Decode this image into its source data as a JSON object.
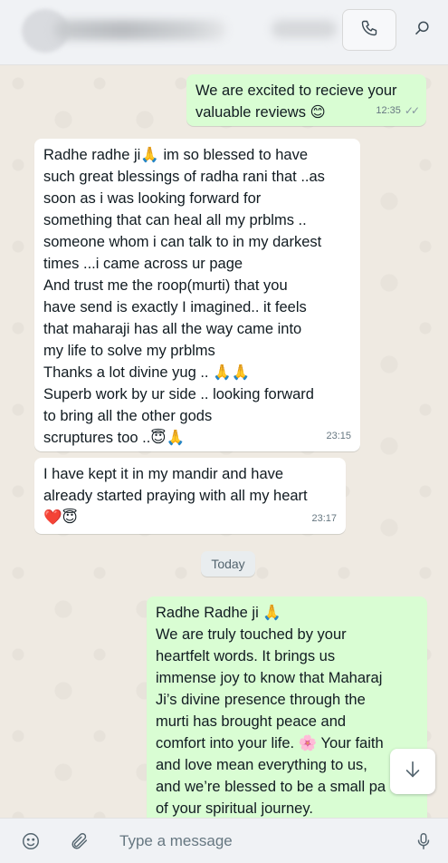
{
  "header": {
    "call_icon": "phone-icon",
    "search_icon": "search-icon"
  },
  "messages": [
    {
      "direction": "out",
      "text": "We are excited to recieve your\nvaluable reviews 😊",
      "time": "12:35",
      "ticks": "✓✓"
    },
    {
      "direction": "in",
      "text": "Radhe radhe ji🙏 im so blessed to have\nsuch great blessings of radha rani that ..as\nsoon as i was looking forward for\nsomething that can heal all my prblms ..\nsomeone whom i can talk to in my darkest\ntimes ...i came across ur page\nAnd trust me the roop(murti) that you\nhave send is exactly I imagined.. it feels\nthat maharaji has all the way came into\nmy life to solve my prblms\nThanks a lot divine yug .. 🙏🙏\nSuperb work by ur side .. looking forward\nto bring all the other gods\nscruptures too ..😇🙏",
      "time": "23:15"
    },
    {
      "direction": "in",
      "text": "I have kept it in my mandir and have\nalready started praying with all my heart\n❤️😇",
      "time": "23:17"
    },
    {
      "direction": "out",
      "text": "Radhe Radhe ji 🙏\nWe are truly touched by your\nheartfelt words. It brings us\nimmense joy to know that Maharaj\nJi’s divine presence through the\nmurti has brought peace and\ncomfort into your life. 🌸 Your faith\nand love mean everything to us,\nand we’re blessed to be a small pa\nof your spiritual journey."
    }
  ],
  "date_separator": "Today",
  "footer": {
    "placeholder": "Type a message",
    "emoji_icon": "smiley-icon",
    "attach_icon": "paperclip-icon",
    "mic_icon": "microphone-icon"
  },
  "scroll_icon": "arrow-down-icon",
  "colors": {
    "outgoing_bubble": "#d9fdd3",
    "incoming_bubble": "#ffffff",
    "background": "#efeae2"
  }
}
